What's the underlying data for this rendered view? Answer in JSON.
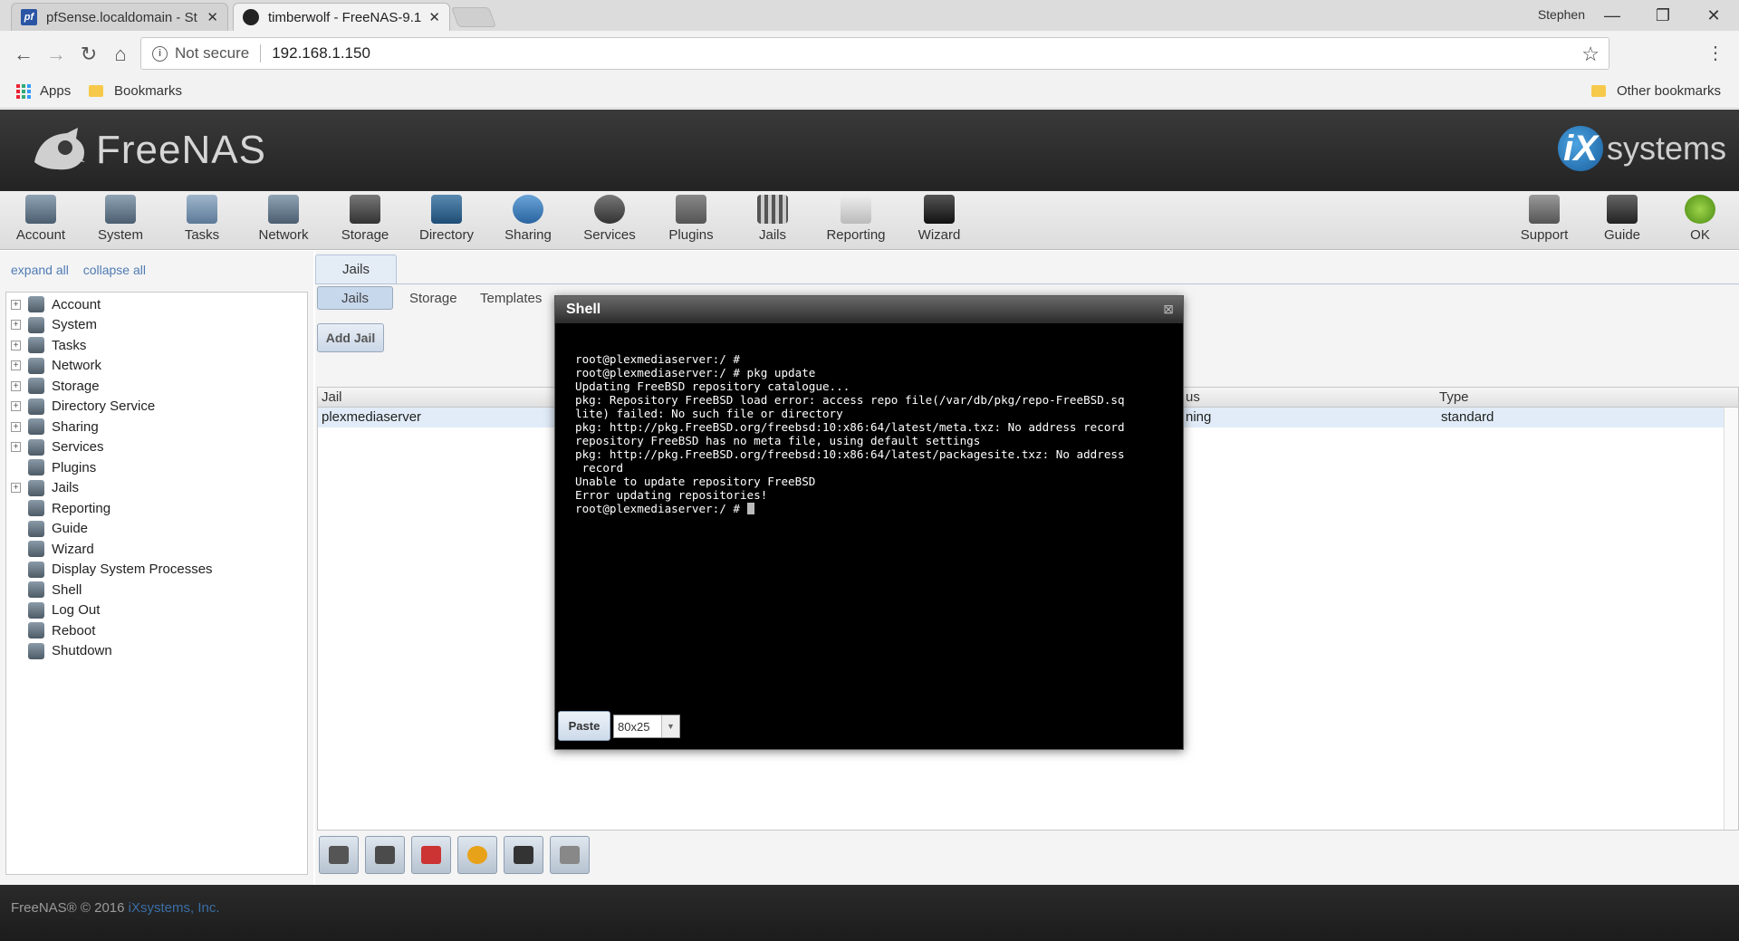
{
  "browser": {
    "tabs": [
      {
        "title": "pfSense.localdomain - St",
        "active": false
      },
      {
        "title": "timberwolf - FreeNAS-9.1",
        "active": true
      }
    ],
    "user": "Stephen",
    "security_label": "Not secure",
    "url": "192.168.1.150",
    "bookmarks": {
      "apps": "Apps",
      "bookmarks": "Bookmarks",
      "other": "Other bookmarks"
    }
  },
  "brand": {
    "product": "FreeNAS",
    "vendor_ix": "iX",
    "vendor_sys": "systems"
  },
  "topmenu": [
    "Account",
    "System",
    "Tasks",
    "Network",
    "Storage",
    "Directory",
    "Sharing",
    "Services",
    "Plugins",
    "Jails",
    "Reporting",
    "Wizard"
  ],
  "topmenu_right": [
    "Support",
    "Guide",
    "OK"
  ],
  "sidebar": {
    "expand_all": "expand all",
    "collapse_all": "collapse all",
    "items": [
      {
        "label": "Account",
        "expandable": true
      },
      {
        "label": "System",
        "expandable": true
      },
      {
        "label": "Tasks",
        "expandable": true
      },
      {
        "label": "Network",
        "expandable": true
      },
      {
        "label": "Storage",
        "expandable": true
      },
      {
        "label": "Directory Service",
        "expandable": true
      },
      {
        "label": "Sharing",
        "expandable": true
      },
      {
        "label": "Services",
        "expandable": true
      },
      {
        "label": "Plugins",
        "expandable": false
      },
      {
        "label": "Jails",
        "expandable": true
      },
      {
        "label": "Reporting",
        "expandable": false
      },
      {
        "label": "Guide",
        "expandable": false
      },
      {
        "label": "Wizard",
        "expandable": false
      },
      {
        "label": "Display System Processes",
        "expandable": false
      },
      {
        "label": "Shell",
        "expandable": false
      },
      {
        "label": "Log Out",
        "expandable": false
      },
      {
        "label": "Reboot",
        "expandable": false
      },
      {
        "label": "Shutdown",
        "expandable": false
      }
    ]
  },
  "main": {
    "outer_tab": "Jails",
    "inner_tabs": [
      "Jails",
      "Storage",
      "Templates"
    ],
    "add_jail": "Add Jail",
    "grid": {
      "col_jail": "Jail",
      "col_status": "us",
      "col_type": "Type",
      "row": {
        "jail": "plexmediaserver",
        "status": "ning",
        "type": "standard"
      }
    }
  },
  "shell": {
    "title": "Shell",
    "lines": [
      "root@plexmediaserver:/ #",
      "root@plexmediaserver:/ # pkg update",
      "Updating FreeBSD repository catalogue...",
      "pkg: Repository FreeBSD load error: access repo file(/var/db/pkg/repo-FreeBSD.sq",
      "lite) failed: No such file or directory",
      "pkg: http://pkg.FreeBSD.org/freebsd:10:x86:64/latest/meta.txz: No address record",
      "repository FreeBSD has no meta file, using default settings",
      "pkg: http://pkg.FreeBSD.org/freebsd:10:x86:64/latest/packagesite.txz: No address",
      " record",
      "Unable to update repository FreeBSD",
      "Error updating repositories!"
    ],
    "prompt": "root@plexmediaserver:/ # ",
    "paste": "Paste",
    "size": "80x25"
  },
  "footer": {
    "copyright": "FreeNAS® © 2016 ",
    "company": "iXsystems, Inc."
  },
  "colors": {
    "accent": "#4f7bb5",
    "header_dark": "#2b2b2b"
  }
}
